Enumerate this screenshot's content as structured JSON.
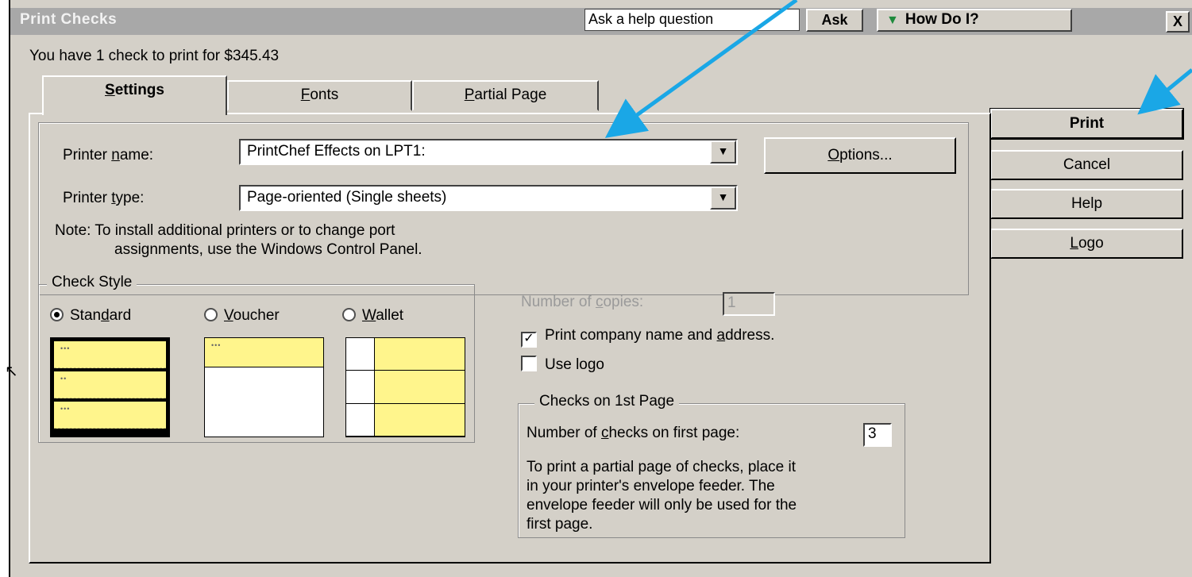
{
  "window": {
    "title": "Print Checks"
  },
  "helpbar": {
    "question_placeholder": "Ask a help question",
    "ask_label": "Ask",
    "howdoi_label": "How Do I?",
    "close_label": "X"
  },
  "summary": "You have 1 check to print for $345.43",
  "tabs": [
    {
      "label": "Settings",
      "key": "S",
      "rest": "ettings"
    },
    {
      "label": "Fonts",
      "key": "F",
      "rest": "onts"
    },
    {
      "label": "Partial Page",
      "key": "P",
      "rest": "artial Page"
    }
  ],
  "printer": {
    "name_label_pre": "Printer ",
    "name_label_key": "n",
    "name_label_post": "ame:",
    "name_value": "PrintChef Effects on LPT1:",
    "type_label_pre": "Printer ",
    "type_label_key": "t",
    "type_label_post": "ype:",
    "type_value": "Page-oriented (Single sheets)",
    "options_key": "O",
    "options_rest": "ptions...",
    "note_line1": "Note: To install additional printers or to change port",
    "note_line2": "assignments, use the Windows Control Panel."
  },
  "check_style": {
    "legend": "Check Style",
    "standard": {
      "pre": "Stan",
      "key": "d",
      "post": "ard",
      "selected": true
    },
    "voucher": {
      "key": "V",
      "rest": "oucher",
      "selected": false
    },
    "wallet": {
      "key": "W",
      "rest": "allet",
      "selected": false
    }
  },
  "copies": {
    "label_pre": "Number of ",
    "label_key": "c",
    "label_post": "opies:",
    "value": "1",
    "enabled": false
  },
  "print_company": {
    "pre": "Print company name and ",
    "key": "a",
    "post": "ddress.",
    "checked": true
  },
  "use_logo": {
    "label": "Use logo",
    "checked": false
  },
  "first_page": {
    "legend": "Checks on 1st Page",
    "label_pre": "Number of ",
    "label_key": "c",
    "label_post": "hecks on first page:",
    "value": "3",
    "note_lines": [
      "To print a partial page of checks, place it",
      "in your printer's envelope feeder.  The",
      "envelope feeder will only be used for the",
      "first page."
    ]
  },
  "buttons": {
    "print": "Print",
    "cancel": "Cancel",
    "help": "Help",
    "logo_key": "L",
    "logo_rest": "ogo"
  },
  "colors": {
    "check_fill": "#fff58c",
    "annotation_arrow": "#1aa7e6",
    "title_bar": "#a8a8a8"
  }
}
